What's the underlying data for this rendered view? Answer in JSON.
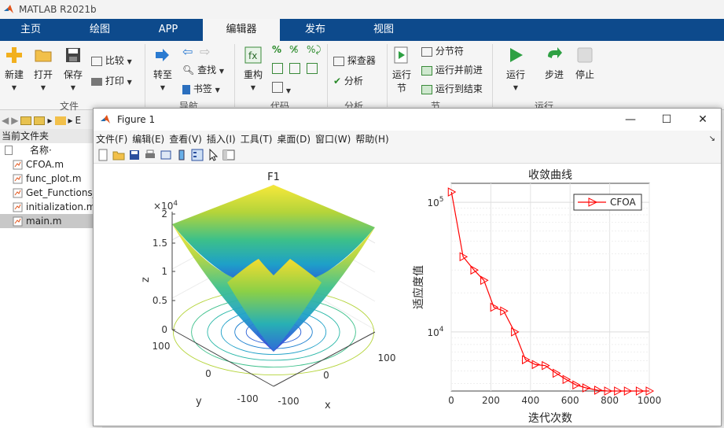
{
  "app": {
    "title": "MATLAB R2021b"
  },
  "tabs": [
    "主页",
    "绘图",
    "APP",
    "编辑器",
    "发布",
    "视图"
  ],
  "active_tab": "编辑器",
  "ribbon": {
    "new_label": "新建",
    "open_label": "打开",
    "save_label": "保存",
    "compare_label": "比较",
    "print_label": "打印",
    "goto_label": "转至",
    "find_label": "查找",
    "bookmark_label": "书签",
    "refactor_label": "重构",
    "inspector_label": "探查器",
    "analyze_label": "分析",
    "run_section_label": "运行\n节",
    "section_break_label": "分节符",
    "run_advance_label": "运行并前进",
    "run_to_end_label": "运行到结束",
    "run_label": "运行",
    "step_label": "步进",
    "stop_label": "停止",
    "groups": {
      "file": "文件",
      "nav": "导航",
      "code": "代码",
      "analyze": "分析",
      "section": "节",
      "run": "运行"
    }
  },
  "file_browser": {
    "path_partial": "E",
    "panel_title": "当前文件夹",
    "col_name": "名称",
    "col_sort": "·",
    "files": [
      {
        "name": "CFOA.m",
        "selected": false
      },
      {
        "name": "func_plot.m",
        "selected": false
      },
      {
        "name": "Get_Functions_",
        "selected": false
      },
      {
        "name": "initialization.m",
        "selected": false
      },
      {
        "name": "main.m",
        "selected": true
      }
    ]
  },
  "figure": {
    "title": "Figure 1",
    "menu": [
      "文件(F)",
      "编辑(E)",
      "查看(V)",
      "插入(I)",
      "工具(T)",
      "桌面(D)",
      "窗口(W)",
      "帮助(H)"
    ],
    "pin_glyph": "↘"
  },
  "chart_data": [
    {
      "type": "surface",
      "title": "F1",
      "xlabel": "x",
      "ylabel": "y",
      "zlabel": "z",
      "z_exponent": "×10",
      "z_exponent_power": "4",
      "z_ticks": [
        "0",
        "0.5",
        "1",
        "1.5",
        "2"
      ],
      "x_ticks": [
        "-100",
        "0",
        "100"
      ],
      "y_ticks": [
        "100",
        "0",
        "-100"
      ],
      "colormap": [
        "#3b1f8f",
        "#2a5fd6",
        "#1ea0c8",
        "#3cc08a",
        "#b4d43a",
        "#f7e83a"
      ],
      "contour_below": true
    },
    {
      "type": "line",
      "title": "收敛曲线",
      "xlabel": "迭代次数",
      "ylabel": "适应度值",
      "yscale": "log",
      "xlim": [
        0,
        1000
      ],
      "ylim": [
        3500,
        140000
      ],
      "x_ticks": [
        "0",
        "200",
        "400",
        "600",
        "800",
        "1000"
      ],
      "y_tick_labels": [
        {
          "base": "10",
          "exp": "4",
          "value": 10000
        },
        {
          "base": "10",
          "exp": "5",
          "value": 100000
        }
      ],
      "legend_position": "top-right",
      "grid": true,
      "series": [
        {
          "name": "CFOA",
          "color": "#ff0000",
          "marker": "triangle-right",
          "x": [
            1,
            60,
            115,
            165,
            215,
            265,
            320,
            375,
            425,
            475,
            530,
            580,
            630,
            680,
            740,
            790,
            840,
            890,
            950,
            1000
          ],
          "y": [
            120000,
            38000,
            30000,
            25000,
            15500,
            14500,
            10000,
            6100,
            5600,
            5500,
            4800,
            4300,
            3900,
            3700,
            3550,
            3500,
            3500,
            3500,
            3500,
            3500
          ]
        }
      ]
    }
  ]
}
